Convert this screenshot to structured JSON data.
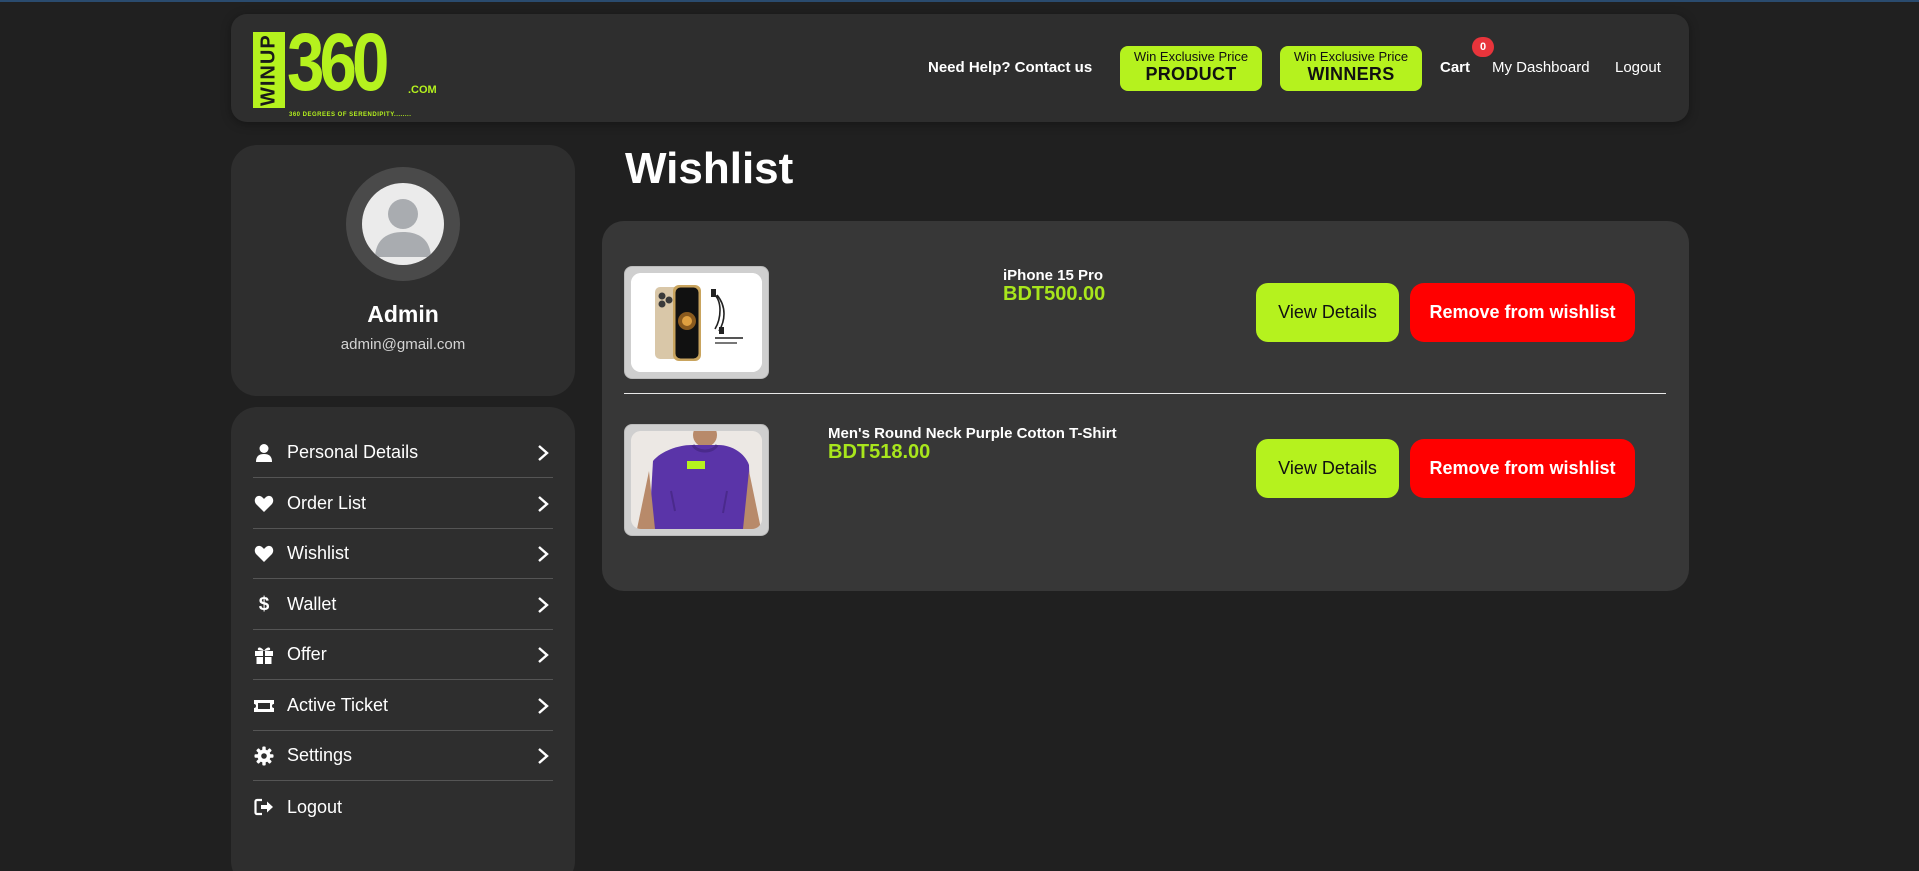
{
  "header": {
    "logo": {
      "word": "WINUP",
      "number": "360",
      "suffix": ".COM",
      "tagline": "360 DEGREES OF SERENDIPITY........"
    },
    "help": "Need Help? Contact us",
    "pill_product": {
      "small": "Win Exclusive Price",
      "big": "PRODUCT"
    },
    "pill_winners": {
      "small": "Win Exclusive Price",
      "big": "WINNERS"
    },
    "cart": "Cart",
    "cart_count": "0",
    "dashboard": "My Dashboard",
    "logout": "Logout"
  },
  "profile": {
    "name": "Admin",
    "email": "admin@gmail.com"
  },
  "sidebar": {
    "items": [
      {
        "label": "Personal Details",
        "icon": "user-icon"
      },
      {
        "label": "Order List",
        "icon": "heart-icon"
      },
      {
        "label": "Wishlist",
        "icon": "heart-icon"
      },
      {
        "label": "Wallet",
        "icon": "dollar-icon"
      },
      {
        "label": "Offer",
        "icon": "gift-icon"
      },
      {
        "label": "Active Ticket",
        "icon": "ticket-icon"
      },
      {
        "label": "Settings",
        "icon": "gear-icon"
      },
      {
        "label": "Logout",
        "icon": "logout-icon"
      }
    ]
  },
  "main": {
    "title": "Wishlist",
    "items": [
      {
        "name": "iPhone 15 Pro",
        "price": "BDT500.00",
        "view": "View Details",
        "remove": "Remove from wishlist"
      },
      {
        "name": "Men's Round Neck Purple Cotton T-Shirt",
        "price": "BDT518.00",
        "view": "View Details",
        "remove": "Remove from wishlist"
      }
    ]
  },
  "colors": {
    "accent": "#b5f21e",
    "danger": "#ff0000",
    "background": "#202020",
    "card": "#2e2e2e"
  }
}
